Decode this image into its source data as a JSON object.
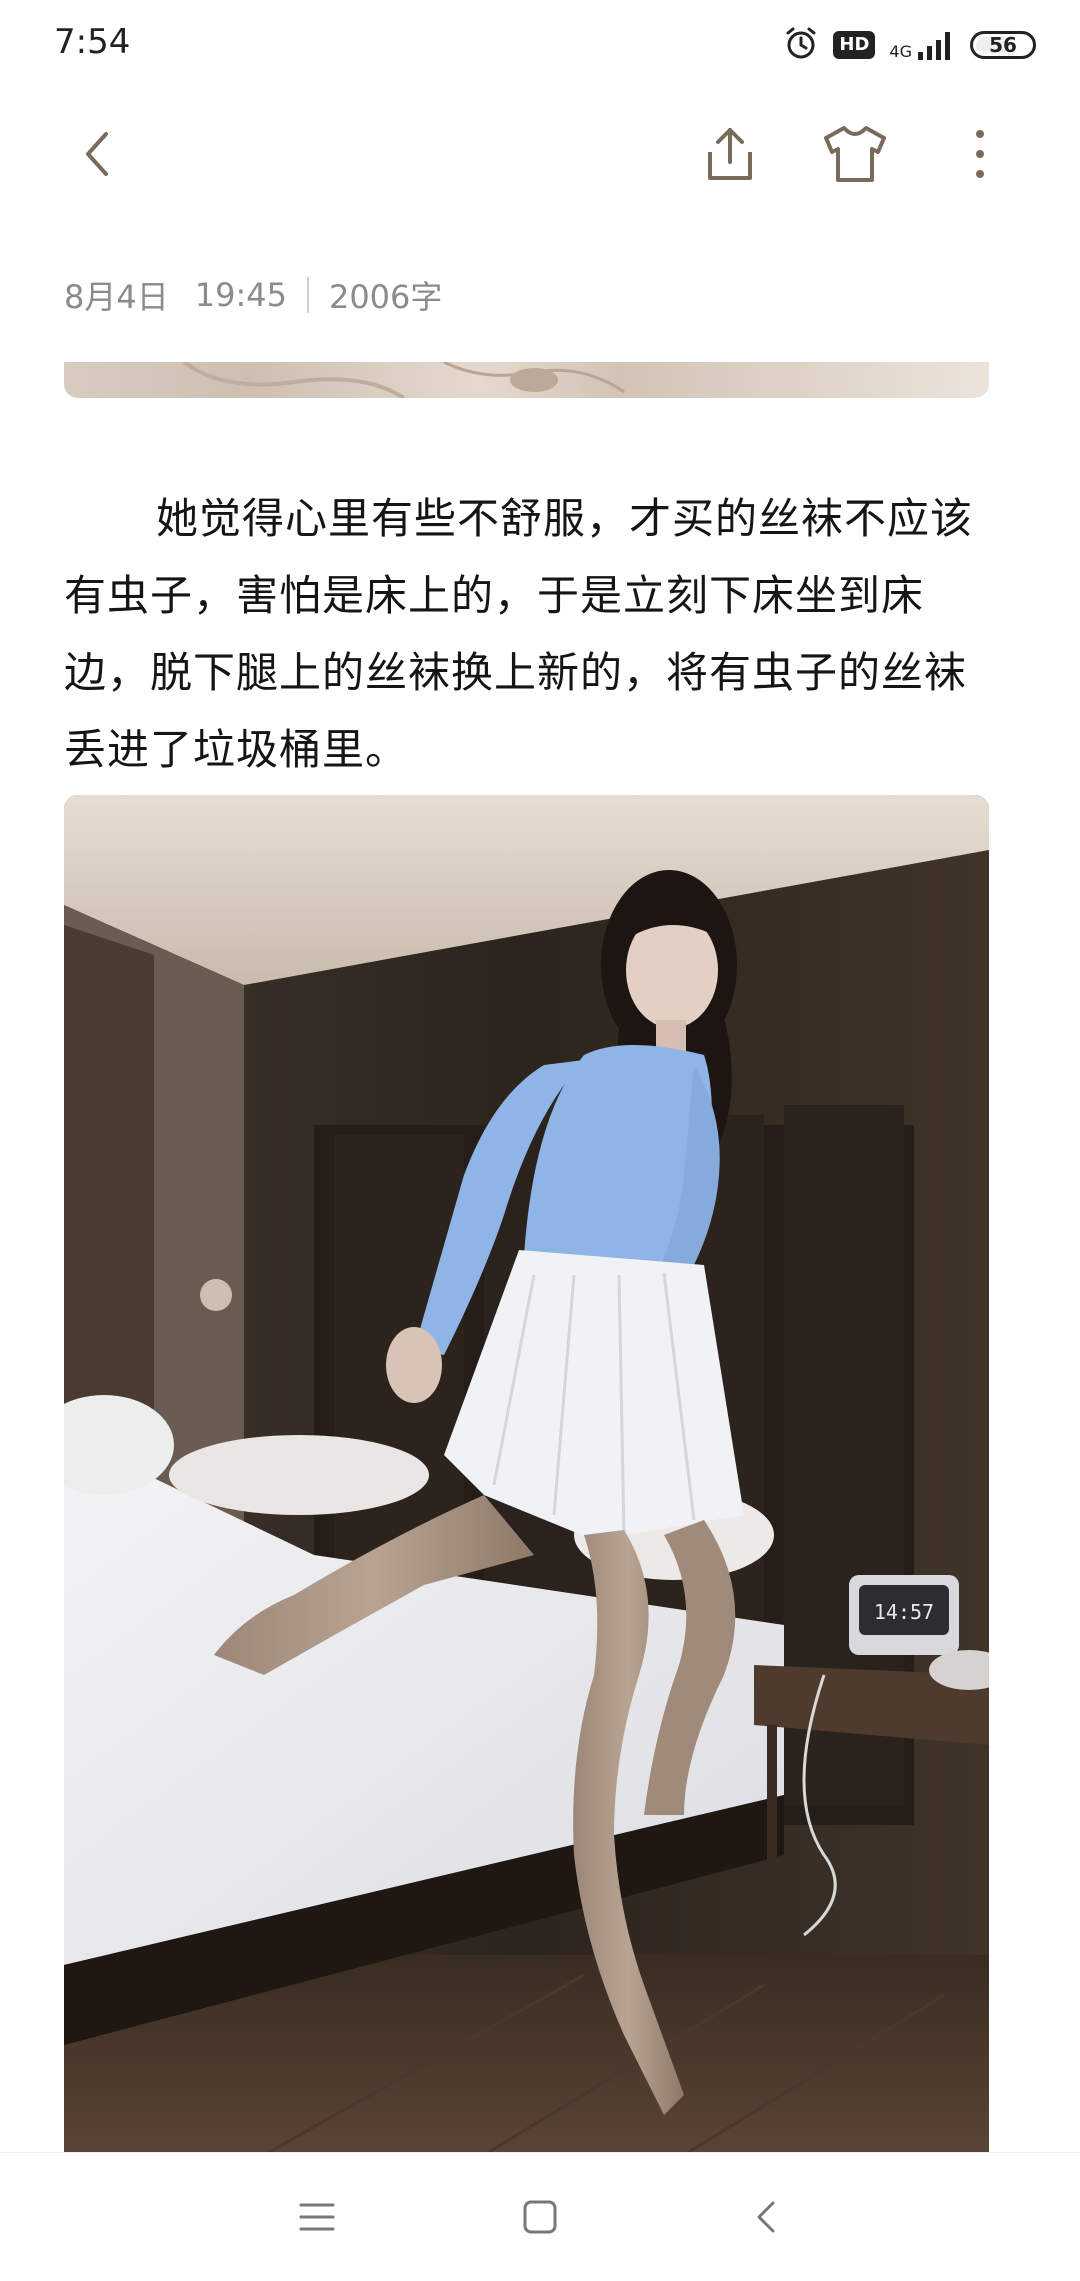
{
  "status_bar": {
    "time": "7:54",
    "hd": "HD",
    "network": "4G",
    "battery": "56"
  },
  "toolbar": {
    "icons": [
      "back-icon",
      "share-icon",
      "tshirt-icon",
      "more-icon"
    ]
  },
  "note": {
    "date": "8月4日",
    "time": "19:45",
    "word_count": "2006字",
    "paragraph": "她觉得心里有些不舒服，才买的丝袜不应该有虫子，害怕是床上的，于是立刻下床坐到床边，脱下腿上的丝袜换上新的，将有虫子的丝袜丢进了垃圾桶里。"
  },
  "photo": {
    "clock_display": "14:57"
  },
  "nav_bar": {
    "icons": [
      "menu-icon",
      "home-icon",
      "back-icon"
    ]
  },
  "colors": {
    "text": "#151515",
    "meta": "#8b8b8b",
    "icon": "#7a6a5a",
    "sweater": "#8fb4e6"
  }
}
